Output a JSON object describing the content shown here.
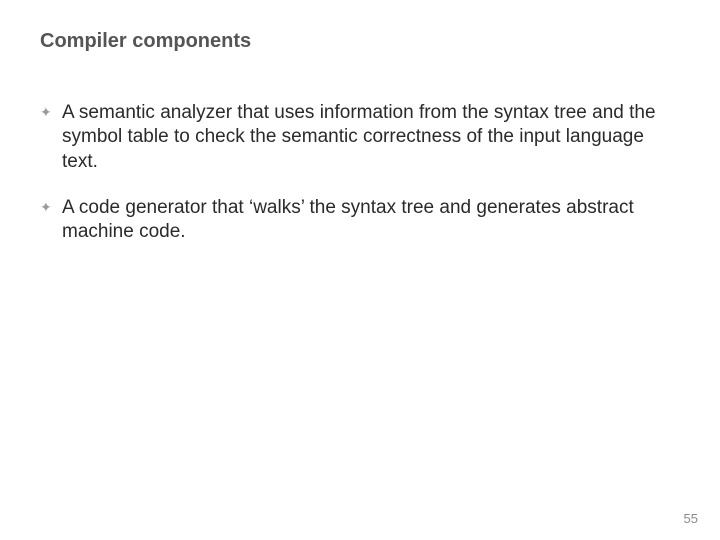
{
  "title": "Compiler components",
  "bullets": [
    "A semantic analyzer that uses information from the syntax tree and the symbol table to check the semantic correctness of the input language text.",
    "A code generator that ‘walks’ the syntax tree and generates abstract machine code."
  ],
  "bullet_marker": "✦",
  "page_number": "55"
}
